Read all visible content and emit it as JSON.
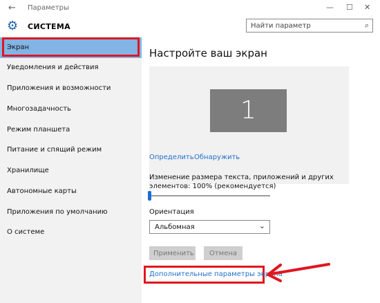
{
  "window": {
    "title": "Параметры",
    "back_glyph": "←",
    "controls": {
      "minimize": "—",
      "maximize": "☐",
      "close": "✕"
    }
  },
  "header": {
    "app_icon": "gear-icon",
    "title": "СИСТЕМА",
    "search": {
      "value": "",
      "placeholder": "Найти параметр",
      "icon": "search-icon"
    }
  },
  "sidebar": {
    "items": [
      {
        "label": "Экран",
        "active": true
      },
      {
        "label": "Уведомления и действия"
      },
      {
        "label": "Приложения и возможности"
      },
      {
        "label": "Многозадачность"
      },
      {
        "label": "Режим планшета"
      },
      {
        "label": "Питание и спящий режим"
      },
      {
        "label": "Хранилище"
      },
      {
        "label": "Автономные карты"
      },
      {
        "label": "Приложения по умолчанию"
      },
      {
        "label": "О системе"
      }
    ]
  },
  "main": {
    "title": "Настройте ваш экран",
    "monitor_number": "1",
    "identify_link": "Определить",
    "detect_link": "Обнаружить",
    "scale_label": "Изменение размера текста, приложений и других элементов: 100% (рекомендуется)",
    "scale_level_fraction": 0.0,
    "orientation_label": "Ориентация",
    "orientation_value": "Альбомная",
    "apply_button": "Применить",
    "cancel_button": "Отмена",
    "advanced_link": "Дополнительные параметры экрана"
  },
  "colors": {
    "accent": "#1f6fcf",
    "selected_nav": "#82b4e5",
    "annotation_red": "#e0161f"
  }
}
